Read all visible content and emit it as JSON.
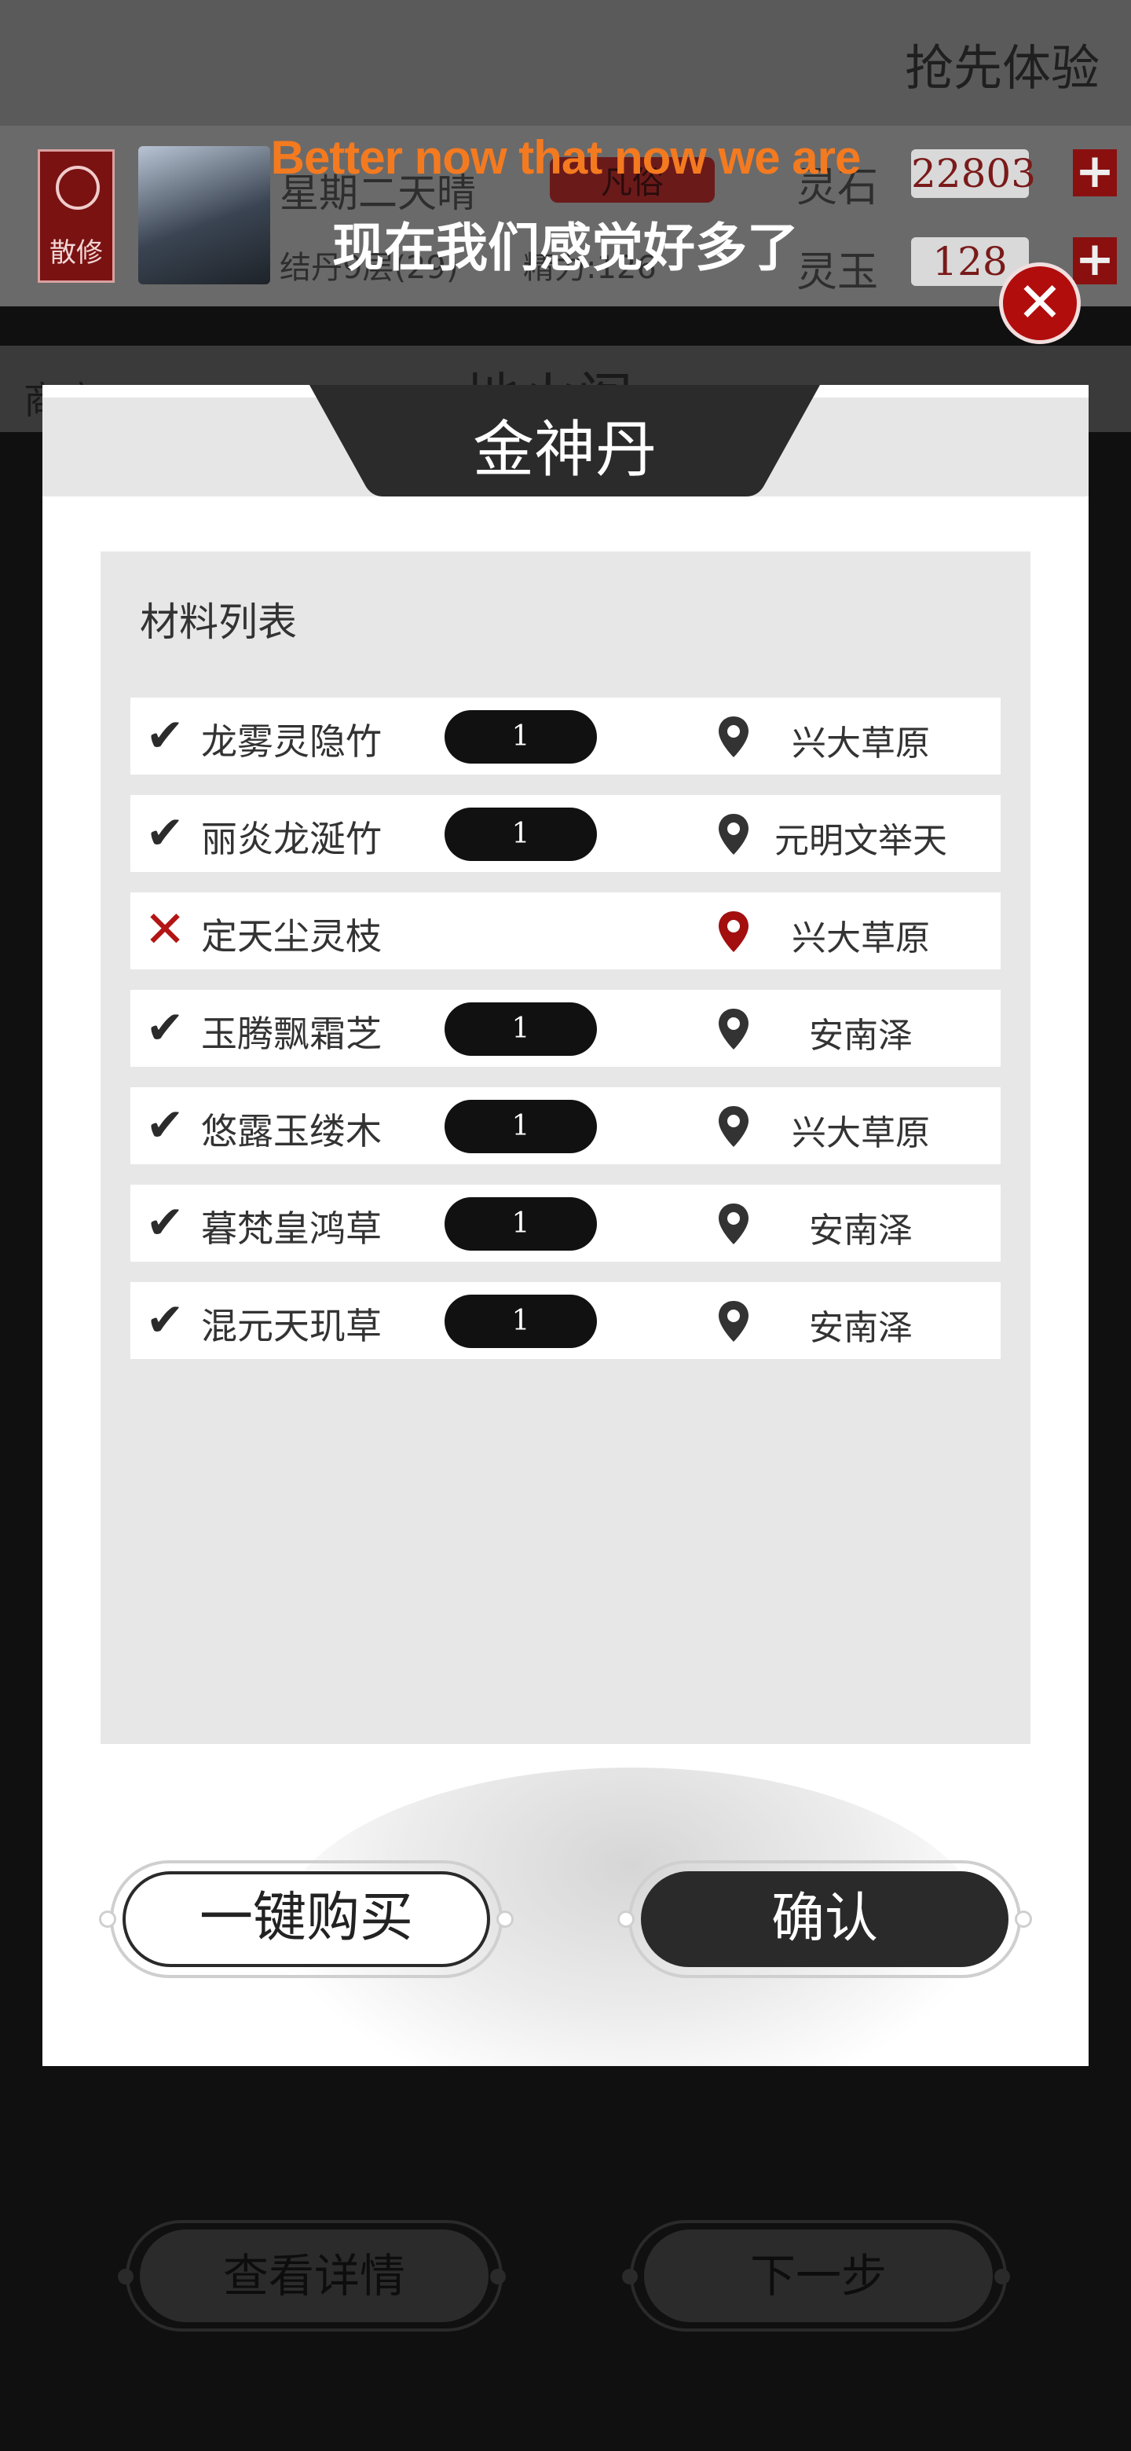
{
  "header": {
    "promo_label": "抢先体验"
  },
  "player": {
    "sect_badge": "散修",
    "date_text": "星期二天晴",
    "realm_badge": "凡俗",
    "status_text": "结丹9层(29)",
    "energy_text": "精力:126",
    "res1_label": "灵石",
    "res1_value": "22803",
    "res2_label": "灵玉",
    "res2_value": "128",
    "plus": "+"
  },
  "subtitle": {
    "english": "Better now that now we are",
    "chinese": "现在我们感觉好多了"
  },
  "close_glyph": "✕",
  "background_nav": {
    "back_label": "商店",
    "page_title": "地火阁"
  },
  "modal": {
    "title": "金神丹",
    "panel_title": "材料列表",
    "materials": [
      {
        "status": "ok",
        "mark": "✔",
        "name": "龙雾灵隐竹",
        "qty": "1",
        "location": "兴大草原"
      },
      {
        "status": "ok",
        "mark": "✔",
        "name": "丽炎龙涎竹",
        "qty": "1",
        "location": "元明文举天"
      },
      {
        "status": "missing",
        "mark": "✕",
        "name": "定天尘灵枝",
        "qty": "",
        "location": "兴大草原"
      },
      {
        "status": "ok",
        "mark": "✔",
        "name": "玉腾飘霜芝",
        "qty": "1",
        "location": "安南泽"
      },
      {
        "status": "ok",
        "mark": "✔",
        "name": "悠露玉缕木",
        "qty": "1",
        "location": "兴大草原"
      },
      {
        "status": "ok",
        "mark": "✔",
        "name": "暮梵皇鸿草",
        "qty": "1",
        "location": "安南泽"
      },
      {
        "status": "ok",
        "mark": "✔",
        "name": "混元天玑草",
        "qty": "1",
        "location": "安南泽"
      }
    ],
    "buy_all_label": "一键购买",
    "confirm_label": "确认"
  },
  "footer": {
    "details_label": "查看详情",
    "next_label": "下一步"
  },
  "colors": {
    "accent_red": "#b20d0d",
    "subtitle_orange": "#f47a20",
    "dark": "#2a2a2a"
  }
}
